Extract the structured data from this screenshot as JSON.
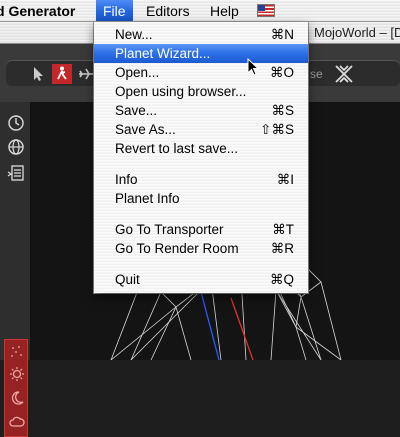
{
  "menubar": {
    "app_name": "d Generator",
    "file": "File",
    "editors": "Editors",
    "help": "Help",
    "flag_icon": "us-flag-icon"
  },
  "window": {
    "title": "MojoWorld – [De"
  },
  "toolbar": {
    "walker_color": "#c4272a",
    "partial_label": "se"
  },
  "file_menu": {
    "items": [
      {
        "label": "New...",
        "shortcut": "⌘N"
      },
      {
        "label": "Planet Wizard...",
        "shortcut": "",
        "highlighted": true
      },
      {
        "label": "Open...",
        "shortcut": "⌘O"
      },
      {
        "label": "Open using browser...",
        "shortcut": ""
      },
      {
        "label": "Save...",
        "shortcut": "⌘S"
      },
      {
        "label": "Save As...",
        "shortcut": "⇧⌘S"
      },
      {
        "label": "Revert to last save...",
        "shortcut": ""
      },
      {
        "label": "Info",
        "shortcut": "⌘I"
      },
      {
        "label": "Planet Info",
        "shortcut": ""
      },
      {
        "label": "Go To Transporter",
        "shortcut": "⌘T"
      },
      {
        "label": "Go To Render Room",
        "shortcut": "⌘R"
      },
      {
        "label": "Quit",
        "shortcut": "⌘Q"
      }
    ]
  },
  "colors": {
    "highlight": "#2b6fe6",
    "red_panel": "#962222"
  }
}
